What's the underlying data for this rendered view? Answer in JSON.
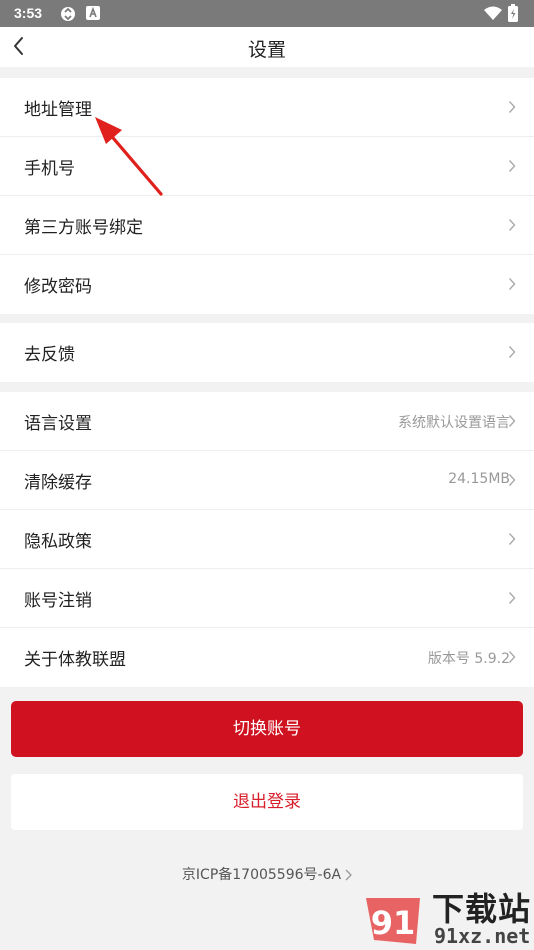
{
  "status_bar": {
    "time": "3:53"
  },
  "header": {
    "title": "设置"
  },
  "groups": [
    {
      "rows": [
        {
          "label": "地址管理"
        },
        {
          "label": "手机号"
        },
        {
          "label": "第三方账号绑定"
        },
        {
          "label": "修改密码"
        }
      ]
    },
    {
      "rows": [
        {
          "label": "去反馈"
        }
      ]
    },
    {
      "rows": [
        {
          "label": "语言设置",
          "value": "系统默认设置语言"
        },
        {
          "label": "清除缓存",
          "value": "24.15MB"
        },
        {
          "label": "隐私政策"
        },
        {
          "label": "账号注销"
        },
        {
          "label": "关于体教联盟",
          "value": "版本号 5.9.2"
        }
      ]
    }
  ],
  "buttons": {
    "switch_account": "切换账号",
    "logout": "退出登录"
  },
  "footer": {
    "icp": "京ICP备17005596号-6A"
  },
  "watermark": {
    "brand": "下载站",
    "domain": "91xz.net",
    "badge": "91"
  },
  "colors": {
    "primary": "#cf1120",
    "logout_text": "#d81e2b",
    "annotation_arrow": "#e0201c"
  }
}
